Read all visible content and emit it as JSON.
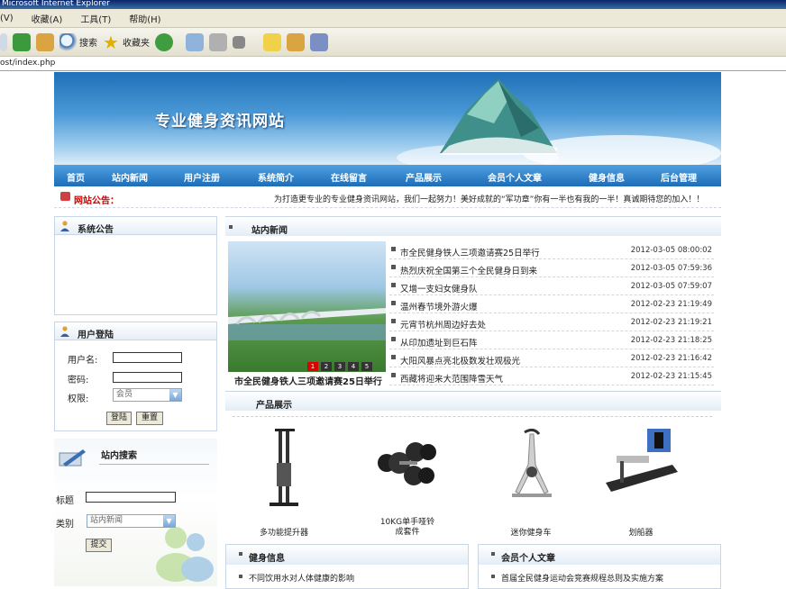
{
  "browser": {
    "title": "Microsoft Internet Explorer",
    "menu": [
      "(V)",
      "收藏(A)",
      "工具(T)",
      "帮助(H)"
    ],
    "toolbar": {
      "search_label": "搜索",
      "favorites_label": "收藏夹"
    },
    "address": "ost/index.php"
  },
  "site": {
    "banner_title": "专业健身资讯网站",
    "nav": [
      "首页",
      "站内新闻",
      "用户注册",
      "系统简介",
      "在线留言",
      "产品展示",
      "会员个人文章",
      "健身信息",
      "后台管理"
    ],
    "notice_label": "网站公告：",
    "notice_text": "为打造更专业的专业健身资讯网站，我们一起努力！美好成就的“军功章”你有一半也有我的一半！真诚期待您的加入！！"
  },
  "sidebar": {
    "system_notice_title": "系统公告",
    "login": {
      "title": "用户登陆",
      "username_label": "用户名:",
      "password_label": "密码:",
      "role_label": "权限:",
      "role_value": "会员",
      "login_button": "登陆",
      "reset_button": "重置"
    },
    "search": {
      "title": "站内搜索",
      "keyword_label": "标题",
      "category_label": "类别",
      "category_value": "站内新闻",
      "submit_button": "提交"
    }
  },
  "news": {
    "title": "站内新闻",
    "slide_numbers": [
      "1",
      "2",
      "3",
      "4",
      "5"
    ],
    "slide_caption": "市全民健身铁人三项邀请赛25日举行",
    "items": [
      {
        "title": "市全民健身铁人三项邀请赛25日举行",
        "date": "2012-03-05 08:00:02"
      },
      {
        "title": "热烈庆祝全国第三个全民健身日到来",
        "date": "2012-03-05 07:59:36"
      },
      {
        "title": "又增一支妇女健身队",
        "date": "2012-03-05 07:59:07"
      },
      {
        "title": "温州春节境外游火爆",
        "date": "2012-02-23 21:19:49"
      },
      {
        "title": "元宵节杭州周边好去处",
        "date": "2012-02-23 21:19:21"
      },
      {
        "title": "从印加遗址到巨石阵",
        "date": "2012-02-23 21:18:25"
      },
      {
        "title": "大阳风暴点亮北极数发壮观极光",
        "date": "2012-02-23 21:16:42"
      },
      {
        "title": "西藏将迎来大范围降雪天气",
        "date": "2012-02-23 21:15:45"
      }
    ]
  },
  "products": {
    "title": "产品展示",
    "items": [
      {
        "name": "多功能提升器"
      },
      {
        "name": "10KG单手哑铃",
        "name2": "成套件"
      },
      {
        "name": "迷你健身车"
      },
      {
        "name": "划船器"
      }
    ]
  },
  "bottom": {
    "fitness_title": "健身信息",
    "fitness_item": "不同饮用水对人体健康的影响",
    "articles_title": "会员个人文章",
    "articles_item": "首届全民健身运动会竞赛规程总则及实施方案"
  }
}
